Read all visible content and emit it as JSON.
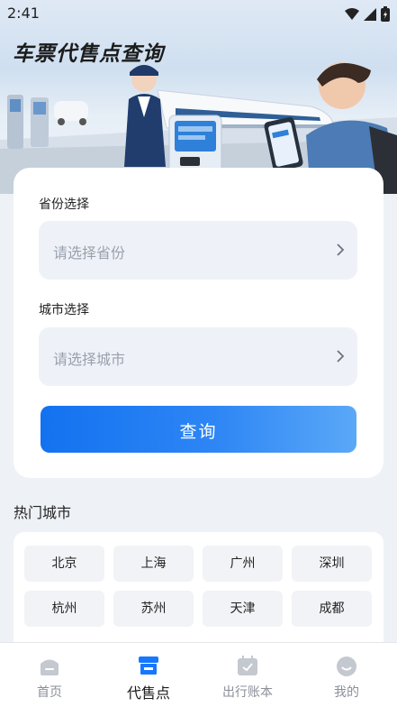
{
  "status_bar": {
    "time": "2:41"
  },
  "page": {
    "title": "车票代售点查询"
  },
  "form": {
    "province_label": "省份选择",
    "province_placeholder": "请选择省份",
    "city_label": "城市选择",
    "city_placeholder": "请选择城市",
    "query_button": "查询"
  },
  "hot_cities": {
    "title": "热门城市",
    "items": [
      "北京",
      "上海",
      "广州",
      "深圳",
      "杭州",
      "苏州",
      "天津",
      "成都"
    ]
  },
  "tabbar": {
    "items": [
      {
        "label": "首页",
        "icon": "home-icon"
      },
      {
        "label": "代售点",
        "icon": "store-icon"
      },
      {
        "label": "出行账本",
        "icon": "ledger-icon"
      },
      {
        "label": "我的",
        "icon": "profile-icon"
      }
    ],
    "active_index": 1
  },
  "colors": {
    "accent": "#1677ff",
    "background": "#eef1f5"
  }
}
